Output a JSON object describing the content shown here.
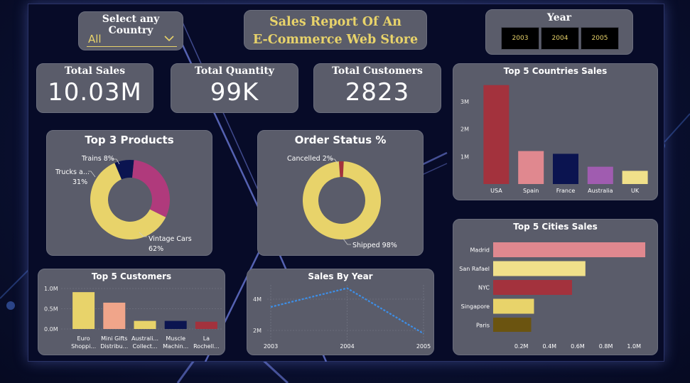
{
  "filters": {
    "country_title": "Select any Country",
    "country_value": "All",
    "year_title": "Year",
    "years": [
      "2003",
      "2004",
      "2005"
    ]
  },
  "report": {
    "title_line1": "Sales Report Of An",
    "title_line2": "E-Commerce Web Store"
  },
  "kpis": {
    "total_sales_label": "Total Sales",
    "total_sales_value": "10.03M",
    "total_quantity_label": "Total Quantity",
    "total_quantity_value": "99K",
    "total_customers_label": "Total Customers",
    "total_customers_value": "2823"
  },
  "colors": {
    "accent_yellow": "#e8d36a",
    "card_bg": "#5a5c6a",
    "red": "#a3323d",
    "pink": "#e0888f",
    "navy": "#0b1450",
    "purple": "#a05cb0",
    "light_yellow": "#f0e08a",
    "magenta": "#b03a7c",
    "line_blue": "#3d8fe8",
    "olive": "#6b5410"
  },
  "chart_data": [
    {
      "id": "top3_products",
      "type": "pie",
      "title": "Top 3 Products",
      "labels": [
        "Vintage Cars",
        "Trucks a...",
        "Trains"
      ],
      "values": [
        62,
        31,
        8
      ],
      "label_texts": [
        "Vintage Cars",
        "62%",
        "Trucks a...",
        "31%",
        "Trains 8%"
      ]
    },
    {
      "id": "order_status",
      "type": "pie",
      "title": "Order Status %",
      "labels": [
        "Shipped",
        "Cancelled"
      ],
      "values": [
        98,
        2
      ],
      "label_texts": [
        "Shipped 98%",
        "Cancelled 2%"
      ]
    },
    {
      "id": "top5_countries",
      "type": "bar",
      "title": "Top 5 Countries Sales",
      "categories": [
        "USA",
        "Spain",
        "France",
        "Australia",
        "UK"
      ],
      "values": [
        3600000,
        1200000,
        1100000,
        630000,
        480000
      ],
      "yticks": [
        "1M",
        "2M",
        "3M"
      ],
      "ylim": [
        0,
        3800000
      ]
    },
    {
      "id": "top5_cities",
      "type": "bar",
      "orientation": "horizontal",
      "title": "Top 5 Cities Sales",
      "categories": [
        "Madrid",
        "San Rafael",
        "NYC",
        "Singapore",
        "Paris"
      ],
      "values": [
        1080000,
        655000,
        560000,
        290000,
        270000
      ],
      "xticks": [
        "0.2M",
        "0.4M",
        "0.6M",
        "0.8M",
        "1.0M"
      ],
      "xlim": [
        0,
        1100000
      ]
    },
    {
      "id": "top5_customers",
      "type": "bar",
      "title": "Top 5 Customers",
      "categories": [
        "Euro Shoppi...",
        "Mini Gifts Distribu...",
        "Australi... Collect...",
        "Muscle Machin...",
        "La Rochell..."
      ],
      "category_lines": [
        [
          "Euro",
          "Shoppi..."
        ],
        [
          "Mini Gifts",
          "Distribu..."
        ],
        [
          "Australi...",
          "Collect..."
        ],
        [
          "Muscle",
          "Machin..."
        ],
        [
          "La",
          "Rochell..."
        ]
      ],
      "values": [
        910000,
        650000,
        200000,
        200000,
        180000
      ],
      "yticks": [
        "0.0M",
        "0.5M",
        "1.0M"
      ],
      "ylim": [
        0,
        1000000
      ]
    },
    {
      "id": "sales_by_year",
      "type": "line",
      "title": "Sales By Year",
      "x": [
        "2003",
        "2004",
        "2005"
      ],
      "values": [
        3500000,
        4700000,
        1800000
      ],
      "yticks": [
        "2M",
        "4M"
      ],
      "ylim": [
        1500000,
        5000000
      ]
    }
  ]
}
